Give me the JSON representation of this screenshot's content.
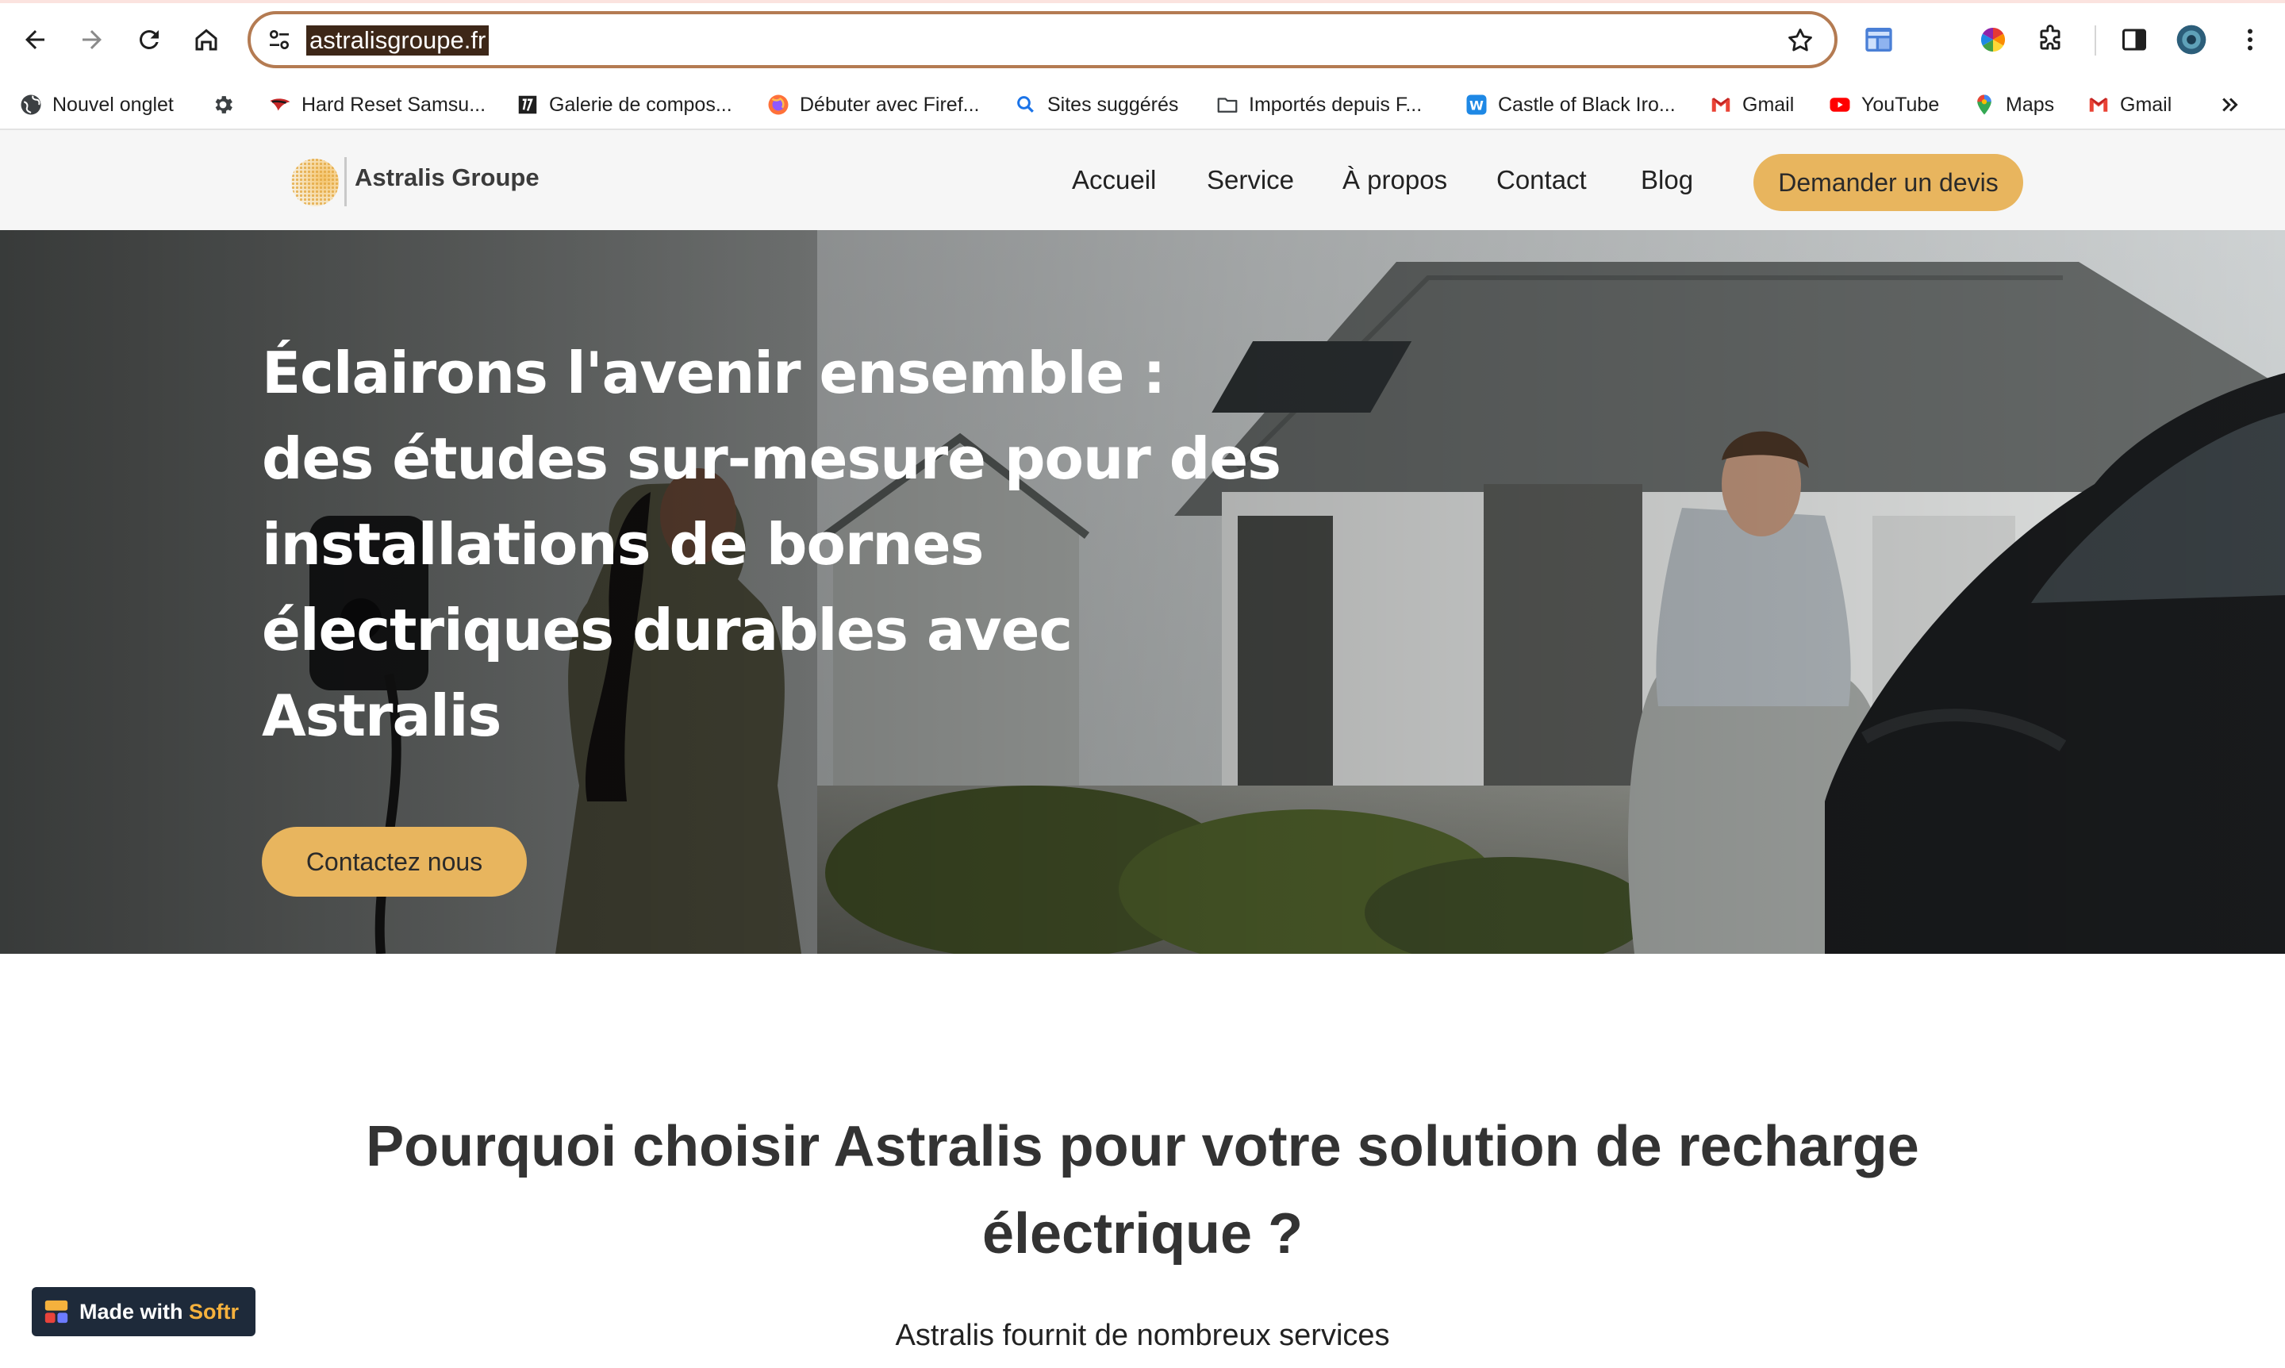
{
  "browser": {
    "url": "astralisgroupe.fr",
    "bookmarks": [
      {
        "label": "Nouvel onglet",
        "icon": "globe-icon"
      },
      {
        "label": "",
        "icon": "gear-icon"
      },
      {
        "label": "Hard Reset Samsu...",
        "icon": "hardreset-icon"
      },
      {
        "label": "Galerie de compos...",
        "icon": "galerie-icon"
      },
      {
        "label": "Débuter avec Firef...",
        "icon": "firefox-icon"
      },
      {
        "label": "Sites suggérés",
        "icon": "search-icon"
      },
      {
        "label": "Importés depuis F...",
        "icon": "folder-icon"
      },
      {
        "label": "Castle of Black Iro...",
        "icon": "castle-icon"
      },
      {
        "label": "Gmail",
        "icon": "gmail-icon"
      },
      {
        "label": "YouTube",
        "icon": "youtube-icon"
      },
      {
        "label": "Maps",
        "icon": "maps-icon"
      },
      {
        "label": "Gmail",
        "icon": "gmail-icon"
      }
    ],
    "colors": {
      "omnibox_border": "#b47b52",
      "url_highlight": "#3d2718"
    }
  },
  "site": {
    "brand": "Astralis Groupe",
    "nav": {
      "items": [
        "Accueil",
        "Service",
        "À propos",
        "Contact",
        "Blog"
      ],
      "cta": "Demander un devis"
    },
    "hero": {
      "title": "Éclairons l'avenir ensemble : des études sur-mesure pour des installations de bornes électriques durables avec Astralis",
      "cta": "Contactez nous"
    },
    "why": {
      "title": "Pourquoi choisir Astralis pour votre solution de recharge électrique ?",
      "subtitle": "Astralis fournit de nombreux services"
    },
    "badge": {
      "prefix": "Made with",
      "brand": "Softr"
    },
    "colors": {
      "accent": "#e8b55e",
      "nav_bg": "#f6f6f6",
      "heading": "#333333"
    }
  }
}
